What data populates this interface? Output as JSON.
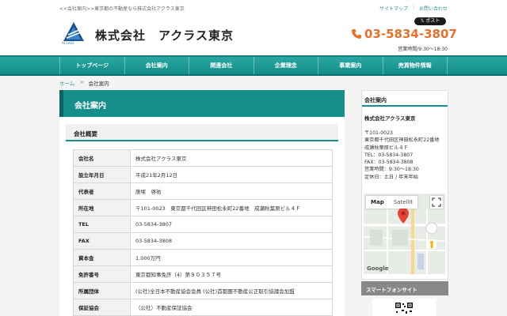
{
  "topbar": {
    "tagline": "<<会社案内>>東京都の不動産なら株式会社アクラス東京",
    "links": [
      "サイトマップ",
      "お問い合わせ"
    ]
  },
  "header": {
    "logo_text": "ACLASS",
    "company_name": "株式会社　アクラス東京",
    "x_button": "ポスト",
    "phone": "03-5834-3807",
    "hours": "営業時間/9:30～18:30"
  },
  "nav": [
    "トップページ",
    "会社案内",
    "関連会社",
    "企業理念",
    "事業案内",
    "売買物件情報"
  ],
  "breadcrumb": {
    "home": "ホーム",
    "sep": ">",
    "current": "会社案内"
  },
  "main": {
    "title": "会社案内",
    "section": "会社概要",
    "rows": [
      {
        "k": "会社名",
        "v": "株式会社アクラス東京"
      },
      {
        "k": "設立年月日",
        "v": "平成21年2月12日"
      },
      {
        "k": "代表者",
        "v": "庚塚　啓祐"
      },
      {
        "k": "所在地",
        "v": "〒101-0023　東京都千代田区神田松永町22番地　成瀬秋葉原ビル４Ｆ"
      },
      {
        "k": "TEL",
        "v": "03-5834-3807"
      },
      {
        "k": "FAX",
        "v": "03-5834-3808"
      },
      {
        "k": "資本金",
        "v": "1,000万円"
      },
      {
        "k": "免許番号",
        "v": "東京都知事免許（4）第９０３５７号"
      },
      {
        "k": "所属団体",
        "v": "(公社)全日本不動産協会会員 (公社)首都圏不動産公正取引協議会加盟"
      },
      {
        "k": "保証協会",
        "v": "（公社）不動産保証協会"
      }
    ]
  },
  "side": {
    "title": "会社案内",
    "company": "株式会社アクラス東京",
    "info": [
      "〒101-0023",
      "東京都千代田区神田松永町22番地　成瀬秋葉原ビル４Ｆ",
      "TEL：03-5834-3807",
      "FAX：03-5834-3808",
      "営業時間：9:30～18:30",
      "定休日：土日 / 年末年始"
    ],
    "map_tabs": [
      "Map",
      "Satellit"
    ],
    "map_brand": "Google",
    "smartphone": "スマートフォンサイト"
  },
  "colors": {
    "accent": "#158f8c",
    "phone": "#e8702a"
  }
}
